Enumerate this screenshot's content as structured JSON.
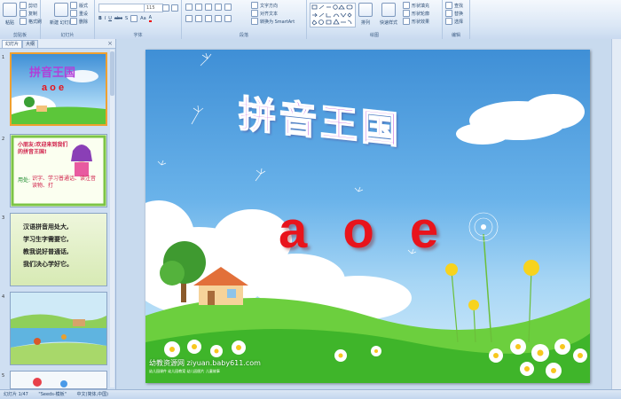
{
  "ribbon": {
    "clipboard": {
      "paste": "粘贴",
      "cut": "剪切",
      "copy": "复制",
      "format": "格式刷",
      "label": "剪贴板"
    },
    "slides": {
      "new_slide": "新建\n幻灯片",
      "layout": "版式",
      "reset": "重设",
      "delete": "删除",
      "label": "幻灯片"
    },
    "font": {
      "family": "",
      "size": "115",
      "label": "字体"
    },
    "paragraph": {
      "text_dir": "文字方向",
      "align_text": "对齐文本",
      "smartart": "转换为 SmartArt",
      "label": "段落"
    },
    "drawing": {
      "arrange": "排列",
      "quick_styles": "快速样式",
      "fill": "形状填充",
      "outline": "形状轮廓",
      "effects": "形状效果",
      "label": "绘图"
    },
    "editing": {
      "find": "查找",
      "replace": "替换",
      "select": "选择",
      "label": "编辑"
    }
  },
  "pane": {
    "tab_slides": "幻灯片",
    "tab_outline": "大纲",
    "close": "×",
    "thumbs": [
      {
        "num": "1",
        "title": "拼音王国",
        "sub": "a o e"
      },
      {
        "num": "2",
        "text": "小朋友:欢迎来到我们的拼音王国!",
        "use": "用处:",
        "use_text": "识字、学习普通话、读注音读物、打"
      },
      {
        "num": "3",
        "lines": [
          "汉语拼音用处大,",
          "学习生字需要它,",
          "教我说好普通话,",
          "我们决心学好它。"
        ]
      },
      {
        "num": "4"
      },
      {
        "num": "5"
      }
    ]
  },
  "slide": {
    "title": "拼音王国",
    "letters": "a o e",
    "watermark": "幼教资源网 ziyuan.baby611.com",
    "watermark_sub": "幼儿园课件 幼儿园教案 幼儿园图片 儿童故事"
  },
  "status": {
    "slide_info": "幻灯片 1/47",
    "theme": "\"Seeds-模板\"",
    "language": "中文(简体,中国)"
  },
  "colors": {
    "title_purple": "#b040d8",
    "letters_red": "#e8141c",
    "ribbon_bg": "#d9e6f5"
  }
}
